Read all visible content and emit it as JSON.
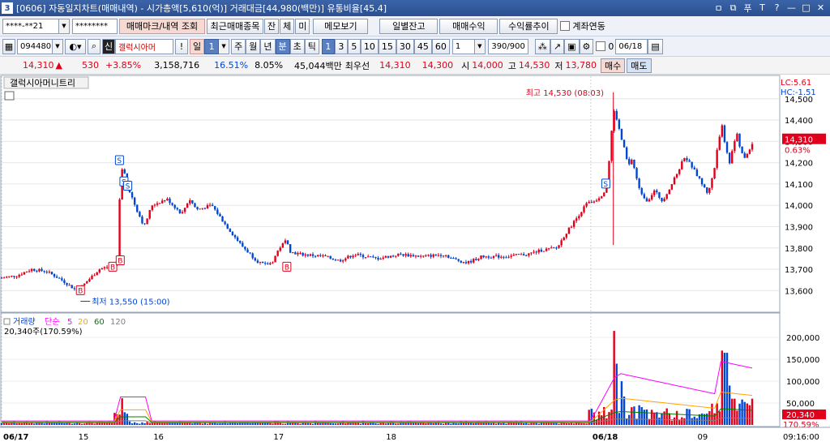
{
  "window": {
    "number": "3",
    "title": "[0606] 자동일지차트(매매내역) - 시가총액[5,610(억)] 거래대금[44,980(백만)] 유통비율[45.4]",
    "buttons": [
      "ㅁ",
      "⧉",
      "푸",
      "T",
      "?",
      "—",
      "□",
      "✕"
    ]
  },
  "toolbar1": {
    "account": "****-**21",
    "password": "********",
    "buttons": [
      "매매마크/내역 조회",
      "최근매매종목",
      "잔",
      "체",
      "미",
      "메모보기",
      "일별잔고",
      "매매수익",
      "수익률추이"
    ],
    "checkbox_label": "계좌연동"
  },
  "toolbar2": {
    "code": "094480",
    "name": "갤럭시아머",
    "period_buttons": [
      "일",
      "주",
      "월",
      "년",
      "분",
      "초",
      "틱"
    ],
    "active_period": "분",
    "minute_buttons": [
      "1",
      "3",
      "5",
      "10",
      "15",
      "30",
      "45",
      "60"
    ],
    "selected_value": "1",
    "count": "390/900",
    "date": "06/18",
    "zero": "0",
    "interval_input": "1",
    "first_field": "1"
  },
  "quote": {
    "price": "14,310",
    "arrow": "▲",
    "change": "530",
    "rate": "+3.85%",
    "volume": "3,158,716",
    "vol_ratio": "16.51%",
    "turnover": "8.05%",
    "amount": "45,044백만",
    "best_label": "최우선",
    "ask": "14,310",
    "bid": "14,300",
    "open_label": "시",
    "open": "14,000",
    "high_label": "고",
    "high": "14,530",
    "low_label": "저",
    "low": "13,780",
    "buy": "매수",
    "sell": "매도"
  },
  "chart_data": {
    "type": "candlestick",
    "title": "갤럭시아머니트리",
    "price_axis": [
      "14,500",
      "14,400",
      "14,300",
      "14,200",
      "14,100",
      "14,000",
      "13,900",
      "13,800",
      "13,700",
      "13,600"
    ],
    "ylim": [
      13510,
      14560
    ],
    "lc_label": "LC:5.61",
    "hc_label": "HC:-1.51",
    "current_price": "14,310",
    "current_rate": "0.63%",
    "high_annotation": "최고 14,530 (08:03)",
    "low_annotation": "최저 13,550 (15:00)",
    "x_labels": [
      "06/17",
      "15",
      "16",
      "17",
      "18",
      "06/18",
      "09",
      "09:16:00"
    ],
    "volume_legend": [
      "거래량",
      "단순",
      "5",
      "20",
      "60",
      "120"
    ],
    "volume_value": "20,340주(170.59%)",
    "volume_axis": [
      "200,000",
      "150,000",
      "100,000",
      "50,000"
    ],
    "volume_current": "20,340",
    "volume_rate": "170.59%",
    "colors": {
      "up": "#e0001b",
      "down": "#0047d4",
      "ma5": "#ff00ff",
      "ma20": "#ffa500",
      "ma60": "#008000",
      "ma120": "#808080"
    },
    "price_path": [
      [
        0.0,
        13660
      ],
      [
        0.02,
        13670
      ],
      [
        0.04,
        13700
      ],
      [
        0.06,
        13690
      ],
      [
        0.08,
        13650
      ],
      [
        0.1,
        13600
      ],
      [
        0.11,
        13630
      ],
      [
        0.13,
        13700
      ],
      [
        0.14,
        13710
      ],
      [
        0.155,
        13730
      ],
      [
        0.158,
        14130
      ],
      [
        0.162,
        14180
      ],
      [
        0.17,
        14070
      ],
      [
        0.18,
        13980
      ],
      [
        0.19,
        13900
      ],
      [
        0.2,
        14000
      ],
      [
        0.22,
        14030
      ],
      [
        0.24,
        13960
      ],
      [
        0.25,
        14030
      ],
      [
        0.26,
        13980
      ],
      [
        0.28,
        14000
      ],
      [
        0.3,
        13900
      ],
      [
        0.32,
        13810
      ],
      [
        0.34,
        13740
      ],
      [
        0.35,
        13720
      ],
      [
        0.36,
        13730
      ],
      [
        0.37,
        13800
      ],
      [
        0.38,
        13840
      ],
      [
        0.385,
        13780
      ],
      [
        0.4,
        13770
      ],
      [
        0.43,
        13760
      ],
      [
        0.45,
        13740
      ],
      [
        0.47,
        13770
      ],
      [
        0.5,
        13750
      ],
      [
        0.53,
        13770
      ],
      [
        0.56,
        13760
      ],
      [
        0.59,
        13770
      ],
      [
        0.6,
        13750
      ],
      [
        0.62,
        13730
      ],
      [
        0.64,
        13760
      ],
      [
        0.67,
        13760
      ],
      [
        0.7,
        13770
      ],
      [
        0.72,
        13790
      ],
      [
        0.74,
        13800
      ],
      [
        0.75,
        13860
      ],
      [
        0.76,
        13910
      ],
      [
        0.77,
        13960
      ],
      [
        0.78,
        14010
      ],
      [
        0.79,
        14020
      ],
      [
        0.8,
        14050
      ],
      [
        0.805,
        14080
      ],
      [
        0.81,
        14230
      ],
      [
        0.815,
        14450
      ],
      [
        0.82,
        14400
      ],
      [
        0.825,
        14320
      ],
      [
        0.83,
        14260
      ],
      [
        0.835,
        14180
      ],
      [
        0.84,
        14220
      ],
      [
        0.845,
        14140
      ],
      [
        0.85,
        14070
      ],
      [
        0.86,
        14020
      ],
      [
        0.87,
        14070
      ],
      [
        0.88,
        14020
      ],
      [
        0.89,
        14080
      ],
      [
        0.9,
        14150
      ],
      [
        0.91,
        14230
      ],
      [
        0.92,
        14180
      ],
      [
        0.93,
        14120
      ],
      [
        0.94,
        14060
      ],
      [
        0.945,
        14100
      ],
      [
        0.95,
        14180
      ],
      [
        0.955,
        14300
      ],
      [
        0.96,
        14380
      ],
      [
        0.965,
        14260
      ],
      [
        0.97,
        14200
      ],
      [
        0.975,
        14290
      ],
      [
        0.98,
        14330
      ],
      [
        0.985,
        14250
      ],
      [
        0.99,
        14220
      ],
      [
        1.0,
        14290
      ]
    ],
    "volume_spikes": [
      [
        0.162,
        61000
      ],
      [
        0.815,
        215000
      ],
      [
        0.82,
        140000
      ],
      [
        0.825,
        100000
      ],
      [
        0.83,
        65000
      ],
      [
        0.85,
        45000
      ],
      [
        0.96,
        170000
      ],
      [
        0.965,
        165000
      ],
      [
        0.97,
        90000
      ],
      [
        0.975,
        60000
      ]
    ]
  }
}
